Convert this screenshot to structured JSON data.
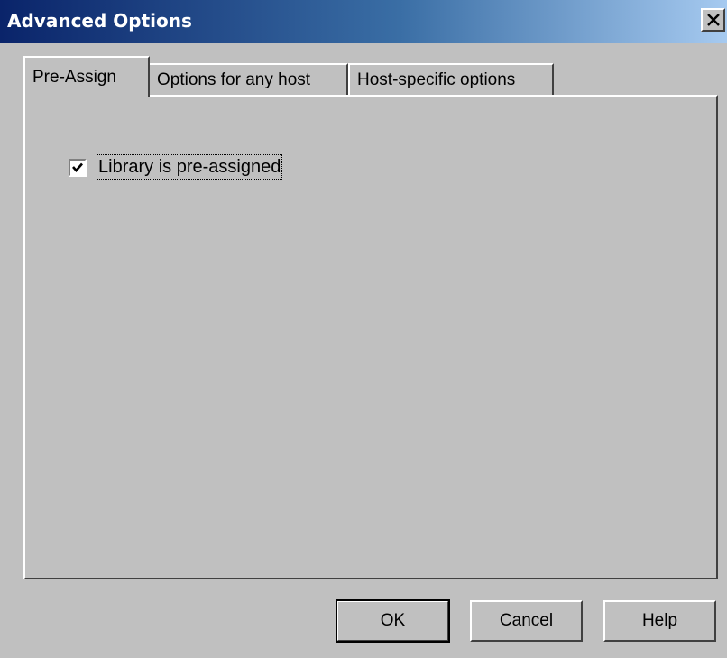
{
  "window": {
    "title": "Advanced Options",
    "close_icon": "close-icon"
  },
  "tabs": [
    {
      "label": "Pre-Assign",
      "active": true
    },
    {
      "label": "Options for any host",
      "active": false
    },
    {
      "label": "Host-specific options",
      "active": false
    }
  ],
  "pre_assign": {
    "checkbox_label": "Library is pre-assigned",
    "checked": true
  },
  "buttons": {
    "ok": "OK",
    "cancel": "Cancel",
    "help": "Help"
  },
  "colors": {
    "titlebar_start": "#0a246a",
    "titlebar_end": "#a6caf0",
    "face": "#c0c0c0"
  }
}
